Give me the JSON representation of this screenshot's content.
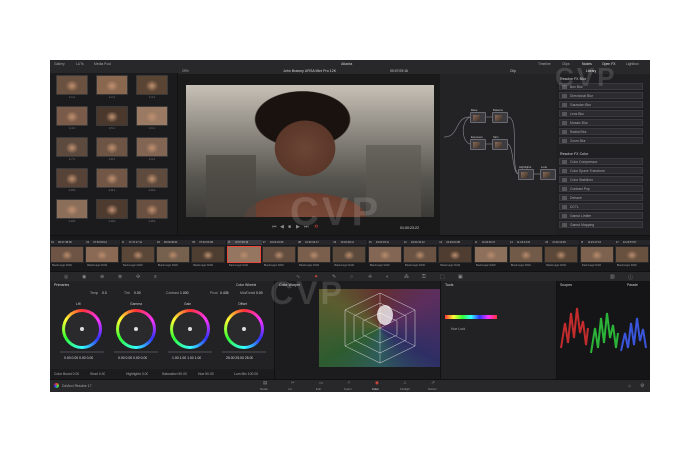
{
  "topbar": {
    "tabs_left": [
      "Gallery",
      "LUTs",
      "Media Pool"
    ],
    "project_title": "Atlanta",
    "tabs_right": [
      "Timeline",
      "Clips",
      "Nodes",
      "Open FX",
      "Lightbox"
    ]
  },
  "viewer": {
    "zoom": "29%",
    "clip_name": "John Brawny URSA Mini Pro 12K",
    "timecode_top": "00:07:09:16",
    "timecode_bottom": "01:00:23:22",
    "mode": "Clip"
  },
  "gallery": {
    "stills": [
      {
        "label": "1.1.1"
      },
      {
        "label": "1.2.1"
      },
      {
        "label": "1.3.1"
      },
      {
        "label": "1.4.1"
      },
      {
        "label": "1.5.1"
      },
      {
        "label": "1.6.1"
      },
      {
        "label": "1.7.1"
      },
      {
        "label": "1.8.1"
      },
      {
        "label": "1.9.1"
      },
      {
        "label": "1.10.1"
      },
      {
        "label": "1.11.1"
      },
      {
        "label": "1.12.1"
      },
      {
        "label": "1.13.1"
      },
      {
        "label": "1.14.1"
      },
      {
        "label": "1.15.1"
      }
    ]
  },
  "nodes": {
    "items": [
      {
        "label": "Base"
      },
      {
        "label": "Balance"
      },
      {
        "label": "Exposure"
      },
      {
        "label": "Skin"
      },
      {
        "label": "Highlights"
      },
      {
        "label": "Look"
      }
    ]
  },
  "library": {
    "tab": "Library",
    "section1": "Resolve FX Blur",
    "section1_items": [
      "Box Blur",
      "Directional Blur",
      "Gaussian Blur",
      "Lens Blur",
      "Mosaic Blur",
      "Radial Blur",
      "Zoom Blur"
    ],
    "section2": "Resolve FX Color",
    "section2_items": [
      "Color Compressor",
      "Color Space Transform",
      "Color Stabilizer",
      "Contrast Pop",
      "Dehaze",
      "DCTL",
      "Gamut Limiter",
      "Gamut Mapping"
    ]
  },
  "timeline": {
    "clips": [
      {
        "num": "01",
        "tc": "00:27:48:06",
        "codec": "Blackmagic RAW"
      },
      {
        "num": "02",
        "tc": "07:52:09:12",
        "codec": "Blackmagic RAW"
      },
      {
        "num": "03",
        "tc": "17:47:17:11",
        "codec": "Blackmagic RAW"
      },
      {
        "num": "04",
        "tc": "06:09:39:01",
        "codec": "Blackmagic RAW"
      },
      {
        "num": "05",
        "tc": "07:02:03:08",
        "codec": "Blackmagic RAW"
      },
      {
        "num": "06",
        "tc": "00:07:09:16",
        "codec": "Blackmagic RAW"
      },
      {
        "num": "07",
        "tc": "10:02:22:06",
        "codec": "Blackmagic RAW"
      },
      {
        "num": "08",
        "tc": "10:02:32:17",
        "codec": "Blackmagic RAW"
      },
      {
        "num": "09",
        "tc": "10:22:29:11",
        "codec": "Blackmagic RAW"
      },
      {
        "num": "10",
        "tc": "04:24:03:12",
        "codec": "Blackmagic RAW"
      },
      {
        "num": "11",
        "tc": "04:24:32:12",
        "codec": "Blackmagic RAW"
      },
      {
        "num": "12",
        "tc": "04:29:04:08",
        "codec": "Blackmagic RAW"
      },
      {
        "num": "13",
        "tc": "10:24:49:17",
        "codec": "Blackmagic RAW"
      },
      {
        "num": "14",
        "tc": "11:23:14:21",
        "codec": "Blackmagic RAW"
      },
      {
        "num": "15",
        "tc": "11:23:13:09",
        "codec": "Blackmagic RAW"
      },
      {
        "num": "16",
        "tc": "11:23:17:10",
        "codec": "Blackmagic RAW"
      },
      {
        "num": "17",
        "tc": "12:23:57:07",
        "codec": "Blackmagic RAW"
      }
    ]
  },
  "primaries": {
    "title": "Primaries",
    "mode": "Color Wheels",
    "temp_label": "Temp",
    "temp_val": "0.0",
    "tint_label": "Tint",
    "tint_val": "0.00",
    "contrast_label": "Contrast",
    "contrast_val": "1.000",
    "pivot_label": "Pivot",
    "pivot_val": "0.435",
    "md_label": "Mid/Detail",
    "md_val": "0.00",
    "wheels": [
      {
        "name": "Lift",
        "values": "0.00  0.00  0.00  0.00"
      },
      {
        "name": "Gamma",
        "values": "0.00  0.00  0.00  0.00"
      },
      {
        "name": "Gain",
        "values": "1.00  1.00  1.00  1.00"
      },
      {
        "name": "Offset",
        "values": "25.00  25.00  25.00"
      }
    ],
    "bottom": [
      "Color Boost  0.00",
      "Shad  0.00",
      "Highlights  0.00",
      "Saturation  50.00",
      "Hue  50.00",
      "Lum Mix  100.00"
    ]
  },
  "warper": {
    "title": "Color Warper"
  },
  "qualifier": {
    "title": "Tools",
    "label": "Hue Lock"
  },
  "scopes": {
    "title": "Scopes",
    "mode": "Parade"
  },
  "bottom_nav": {
    "app": "DaVinci Resolve 17",
    "pages": [
      "Media",
      "Cut",
      "Edit",
      "Fusion",
      "Color",
      "Fairlight",
      "Deliver"
    ],
    "active": "Color"
  },
  "watermark": "CVP",
  "colors": {
    "accent": "#e8483c",
    "panel": "#1e1e20",
    "bar": "#28282b"
  }
}
